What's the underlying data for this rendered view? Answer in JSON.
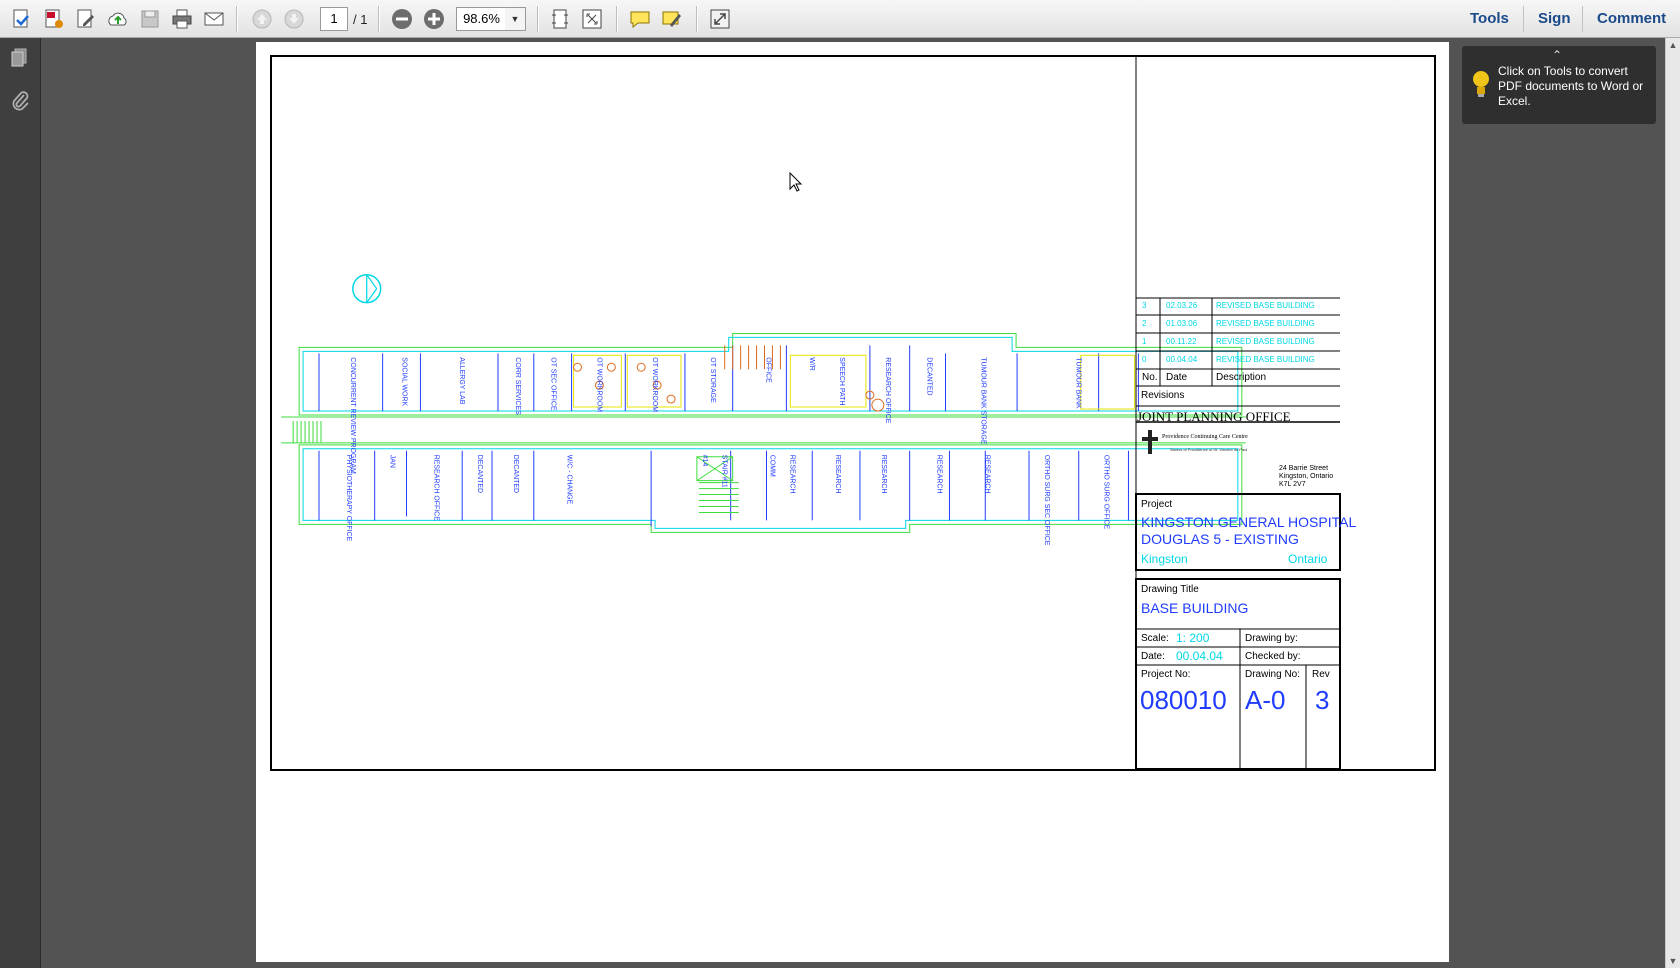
{
  "toolbar": {
    "page_current": "1",
    "page_total": "/ 1",
    "zoom_value": "98.6%",
    "tools_label": "Tools",
    "sign_label": "Sign",
    "comment_label": "Comment"
  },
  "tip": {
    "text": "Click on Tools to convert PDF documents to Word or Excel."
  },
  "drawing": {
    "revisions": [
      {
        "no": "3",
        "date": "02.03.26",
        "description": "REVISED BASE BUILDING"
      },
      {
        "no": "2",
        "date": "01.03.06",
        "description": "REVISED BASE BUILDING"
      },
      {
        "no": "1",
        "date": "00.11.22",
        "description": "REVISED BASE BUILDING"
      },
      {
        "no": "0",
        "date": "00.04.04",
        "description": "REVISED BASE BUILDING"
      }
    ],
    "rev_head_no": "No.",
    "rev_head_date": "Date",
    "rev_head_desc": "Description",
    "revisions_label": "Revisions",
    "office": "JOINT PLANNING OFFICE",
    "logo_name": "Providence Continuing Care Centre",
    "logo_sub": "Sisters of Providence of St. Vincent de Paul",
    "address_line1": "24 Barrie Street",
    "address_line2": "Kingston, Ontario",
    "address_line3": "K7L 2V7",
    "project_label": "Project",
    "project_line1": "KINGSTON GENERAL HOSPITAL",
    "project_line2": "DOUGLAS 5 - EXISTING",
    "city": "Kingston",
    "province": "Ontario",
    "drawing_title_label": "Drawing Title",
    "drawing_title": "BASE BUILDING",
    "scale_label": "Scale:",
    "scale_value": "1: 200",
    "drawing_by_label": "Drawing by:",
    "date_label": "Date:",
    "date_value": "00.04.04",
    "checked_by_label": "Checked by:",
    "project_no_label": "Project No:",
    "project_no": "080010",
    "drawing_no_label": "Drawing No:",
    "drawing_no": "A-0",
    "rev_label": "Rev",
    "rev_value": "3",
    "rooms_top": [
      "CONCURRENT REVIEW PROGRAM",
      "SOCIAL WORK",
      "ALLERGY LAB",
      "CORR SERVICES",
      "OT SEC OFFICE",
      "OT WORKROOM",
      "OT WORKROOM",
      "OT STORAGE",
      "OFFICE",
      "W/R",
      "SPEECH PATH",
      "RESEARCH OFFICE",
      "DECANTED",
      "TUMOUR BANK STORAGE",
      "TUMOUR BANK"
    ],
    "rooms_bottom": [
      "PHYSIOTHERAPY OFFICE",
      "JAN",
      "RESEARCH OFFICE",
      "DECANTED",
      "DECANTED",
      "W/C - CHANGE",
      "#14",
      "STAIR #11",
      "COMM",
      "RESEARCH",
      "RESEARCH",
      "RESEARCH",
      "RESEARCH",
      "RESEARCH",
      "ORTHO SURG SEC OFFICE",
      "ORTHO SURG OFFICE"
    ]
  },
  "colors": {
    "cad_cyan": "#00d7e6",
    "cad_green": "#3cdc3c",
    "cad_blue": "#1f3cff",
    "cad_yellow": "#e6e600",
    "cad_orange": "#e06a1a",
    "link_blue": "#1a4a8a"
  },
  "icons": [
    "create-pdf-icon",
    "convert-pdf-icon",
    "edit-pdf-icon",
    "upload-icon",
    "save-icon",
    "print-icon",
    "email-icon",
    "prev-page-icon",
    "next-page-icon",
    "zoom-out-icon",
    "zoom-in-icon",
    "fit-page-icon",
    "fit-width-icon",
    "comment-icon",
    "highlight-icon",
    "fullscreen-icon",
    "pages-panel-icon",
    "attachment-icon",
    "lightbulb-icon",
    "collapse-chevron-icon",
    "mouse-cursor-icon",
    "north-arrow-icon"
  ]
}
